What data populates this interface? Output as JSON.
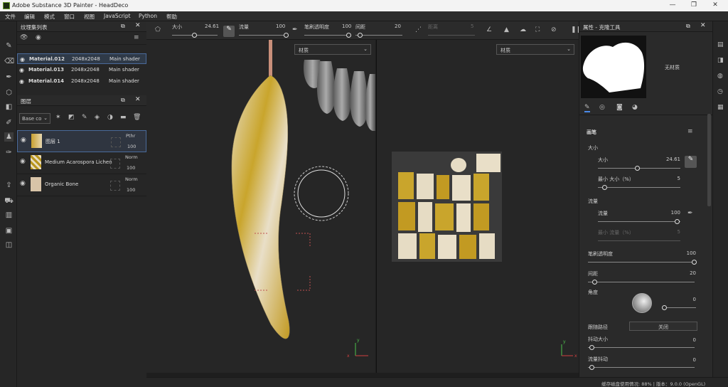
{
  "app": {
    "title": "Adobe Substance 3D Painter - HeadDeco",
    "window_controls": [
      "—",
      "❐",
      "✕"
    ]
  },
  "menu": [
    "文件",
    "编辑",
    "模式",
    "窗口",
    "视图",
    "JavaScript",
    "Python",
    "帮助"
  ],
  "texture_set": {
    "title": "纹理集列表",
    "rows": [
      {
        "name": "Material.012",
        "res": "2048x2048",
        "shader": "Main shader"
      },
      {
        "name": "Material.013",
        "res": "2048x2048",
        "shader": "Main shader"
      },
      {
        "name": "Material.014",
        "res": "2048x2048",
        "shader": "Main shader"
      }
    ]
  },
  "layers": {
    "title": "图层",
    "blend_select": "Base co",
    "rows": [
      {
        "name": "图层 1",
        "blend": "Pthr",
        "opacity": "100"
      },
      {
        "name": "Medium Acarospora Lichen",
        "blend": "Norm",
        "opacity": "100"
      },
      {
        "name": "Organic Bone",
        "blend": "Norm",
        "opacity": "100"
      }
    ]
  },
  "toolbar": {
    "size_label": "大小",
    "size_val": "24.61",
    "flow_label": "流量",
    "flow_val": "100",
    "opacity_label": "笔刷透明度",
    "opacity_val": "100",
    "spacing_label": "间距",
    "spacing_val": "20",
    "distance_label": "距离",
    "distance_val": "5"
  },
  "viewport": {
    "left_dd": "材质",
    "right_dd": "材质",
    "axis_x": "x",
    "axis_y": "y",
    "axis_z": "z"
  },
  "props": {
    "title": "属性 - 克隆工具",
    "no_material": "无材质",
    "section_brush": "画笔",
    "size_group": "大小",
    "size_label": "大小",
    "size_val": "24.61",
    "min_size_label": "最小 大小（%）",
    "min_size_val": "5",
    "flow_group": "流量",
    "flow_label": "流量",
    "flow_val": "100",
    "min_flow_label": "最小 流量（%）",
    "min_flow_val": "5",
    "opacity_label": "笔刷透明度",
    "opacity_val": "100",
    "spacing_label": "间距",
    "spacing_val": "20",
    "angle_label": "角度",
    "angle_val": "0",
    "follow_label": "跟随路径",
    "follow_val": "关闭",
    "jitter_size_label": "抖动大小",
    "jitter_size_val": "0",
    "flow_jitter_label": "流量抖动",
    "flow_jitter_val": "0"
  },
  "status": {
    "text": "缓存磁盘使用情况:  88%  |  版本：9.0.0 (OpenGL)"
  }
}
